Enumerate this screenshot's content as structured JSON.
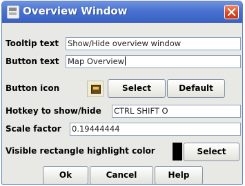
{
  "window": {
    "title": "Overview Window",
    "title_bar_color": "#4a72d0"
  },
  "tooltip_text": {
    "label": "Tooltip text",
    "value": "Show/Hide overview window"
  },
  "button_text": {
    "label": "Button text",
    "value": "Map Overview"
  },
  "button_icon": {
    "label": "Button icon",
    "icon": "map-window-icon",
    "select_label": "Select",
    "default_label": "Default"
  },
  "hotkey": {
    "label": "Hotkey to show/hide",
    "value": "CTRL SHIFT O"
  },
  "scale_factor": {
    "label": "Scale factor",
    "value": "0.19444444"
  },
  "highlight_color": {
    "label": "Visible rectangle highlight color",
    "color": "#000000",
    "select_label": "Select"
  },
  "footer": {
    "ok_label": "Ok",
    "cancel_label": "Cancel",
    "help_label": "Help"
  }
}
